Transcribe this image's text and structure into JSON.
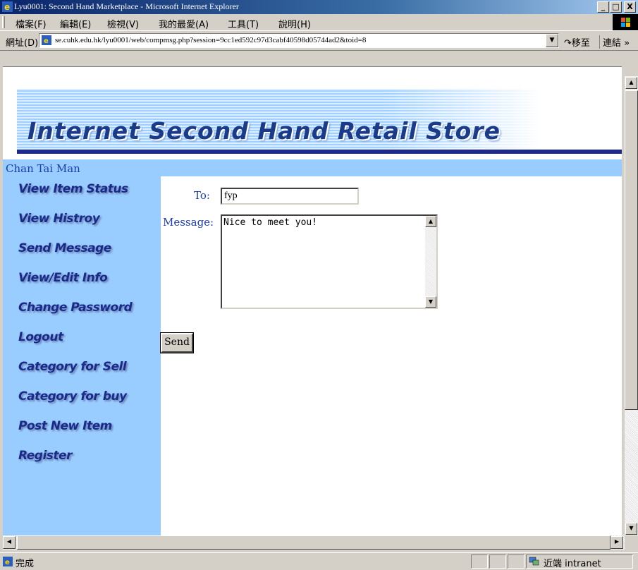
{
  "window": {
    "title": "Lyu0001: Second Hand Marketplace - Microsoft Internet Explorer",
    "controls": {
      "minimize": "_",
      "maximize": "□",
      "close": "X"
    }
  },
  "menu": [
    {
      "label": "檔案(F)"
    },
    {
      "label": "編輯(E)"
    },
    {
      "label": "檢視(V)"
    },
    {
      "label": "我的最愛(A)"
    },
    {
      "label": "工具(T)"
    },
    {
      "label": "說明(H)"
    }
  ],
  "address": {
    "label": "網址(D)",
    "url": "se.cuhk.edu.hk/lyu0001/web/compmsg.php?session=9cc1ed592c97d3cabf40598d05744ad2&toid=8",
    "go_label": "移至",
    "links_label": "連結 »"
  },
  "page": {
    "banner_title": "Internet Second Hand Retail Store",
    "username": "Chan Tai Man",
    "nav": [
      {
        "label": "View Item Status"
      },
      {
        "label": "View Histroy"
      },
      {
        "label": "Send Message"
      },
      {
        "label": "View/Edit Info"
      },
      {
        "label": "Change Password"
      },
      {
        "label": "Logout"
      },
      {
        "label": "Category for Sell"
      },
      {
        "label": "Category for buy"
      },
      {
        "label": "Post New Item"
      },
      {
        "label": "Register"
      }
    ],
    "form": {
      "to_label": "To:",
      "to_value": "fyp",
      "message_label": "Message:",
      "message_value": "Nice to meet you!",
      "send_label": "Send"
    }
  },
  "status": {
    "text": "完成",
    "zone": "近端 intranet"
  },
  "colors": {
    "sidebar_bg": "#99ccff",
    "nav_text": "#1a2a8a",
    "label_text": "#1c3cb0",
    "banner_rule": "#1e2a8a"
  }
}
